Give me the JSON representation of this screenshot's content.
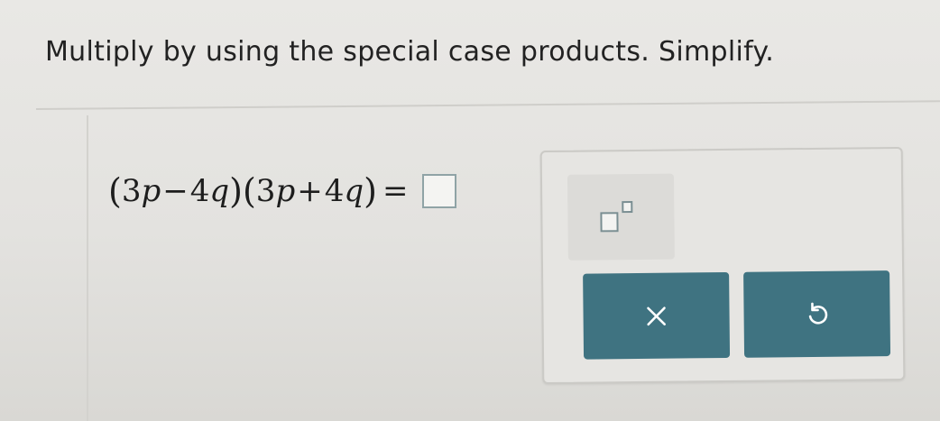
{
  "question": {
    "instruction": "Multiply by using the special case products. Simplify."
  },
  "equation": {
    "open_paren_1": "(",
    "coef_1": "3",
    "var_p_1": "p",
    "op_1": "−",
    "coef_2": "4",
    "var_q_1": "q",
    "close_paren_1": ")",
    "open_paren_2": "(",
    "coef_3": "3",
    "var_p_2": "p",
    "op_2": "+",
    "coef_4": "4",
    "var_q_2": "q",
    "close_paren_2": ")",
    "equals": "=",
    "answer_value": ""
  },
  "keypad": {
    "exponent_icon": "exponent-template-icon",
    "clear_icon": "times-icon",
    "undo_icon": "undo-icon",
    "button_color": "#3f7381"
  }
}
